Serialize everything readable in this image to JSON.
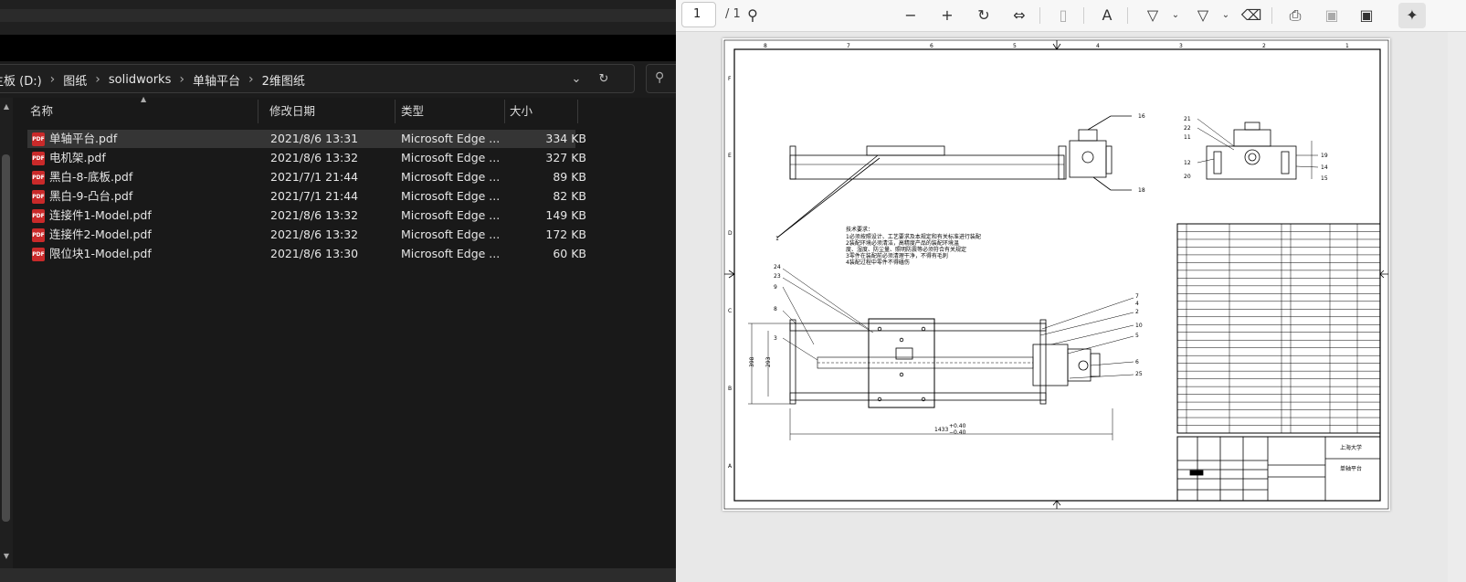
{
  "explorer": {
    "breadcrumb": [
      "主板 (D:)",
      "图纸",
      "solidworks",
      "单轴平台",
      "2维图纸"
    ],
    "columns": {
      "name": "名称",
      "date": "修改日期",
      "type": "类型",
      "size": "大小"
    },
    "files": [
      {
        "name": "单轴平台.pdf",
        "date": "2021/8/6 13:31",
        "type": "Microsoft Edge ...",
        "size": "334 KB",
        "selected": true
      },
      {
        "name": "电机架.pdf",
        "date": "2021/8/6 13:32",
        "type": "Microsoft Edge ...",
        "size": "327 KB"
      },
      {
        "name": "黑白-8-底板.pdf",
        "date": "2021/7/1 21:44",
        "type": "Microsoft Edge ...",
        "size": "89 KB"
      },
      {
        "name": "黑白-9-凸台.pdf",
        "date": "2021/7/1 21:44",
        "type": "Microsoft Edge ...",
        "size": "82 KB"
      },
      {
        "name": "连接件1-Model.pdf",
        "date": "2021/8/6 13:32",
        "type": "Microsoft Edge ...",
        "size": "149 KB"
      },
      {
        "name": "连接件2-Model.pdf",
        "date": "2021/8/6 13:32",
        "type": "Microsoft Edge ...",
        "size": "172 KB"
      },
      {
        "name": "限位块1-Model.pdf",
        "date": "2021/8/6 13:30",
        "type": "Microsoft Edge ...",
        "size": "60 KB"
      }
    ],
    "icons": {
      "file": "pdf-file-icon",
      "dropdown": "chevron-down-icon",
      "refresh": "refresh-icon",
      "search": "search-icon"
    },
    "pdf_badge": "PDF"
  },
  "viewer": {
    "page_number": "1",
    "page_total": "/ 1",
    "drawing": {
      "tech_title": "技术要求：",
      "tech_lines": [
        "1必须按照设计、工艺要求及本规定和有关标准进行装配",
        "2装配环境必须清洁，高精度产品的装配环境温",
        "度、湿度、防尘量、照明防震等必须符合有关规定",
        "3零件在装配前必须清理干净，不得有毛刺",
        "4装配过程中零件不得磕伤"
      ],
      "title_school": "上海大学",
      "title_name": "单轴平台",
      "dim_total": "1433",
      "dim_tol_top": "+0.40",
      "dim_tol_bottom": "−0.40",
      "dim_398": "398",
      "dim_293": "293",
      "zones_top": [
        "8",
        "7",
        "6",
        "5",
        "4",
        "3",
        "2",
        "1"
      ],
      "zones_side": [
        "F",
        "E",
        "D",
        "C",
        "B",
        "A"
      ]
    }
  }
}
